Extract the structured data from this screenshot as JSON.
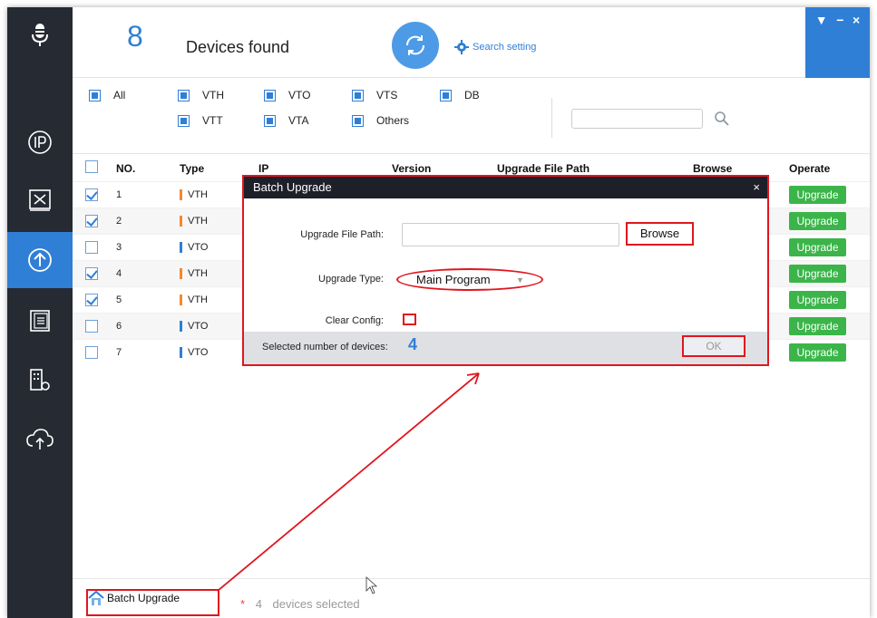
{
  "header": {
    "device_count": "8",
    "found_label": "Devices found",
    "search_setting_label": "Search setting",
    "window_controls": [
      "▼",
      "−",
      "×"
    ]
  },
  "filters": {
    "all_label": "All",
    "types": [
      {
        "label": "VTH"
      },
      {
        "label": "VTO"
      },
      {
        "label": "VTS"
      },
      {
        "label": "DB"
      },
      {
        "label": "VTT"
      },
      {
        "label": "VTA"
      },
      {
        "label": "Others"
      }
    ],
    "search_value": ""
  },
  "table": {
    "headers": {
      "no": "NO.",
      "type": "Type",
      "ip": "IP",
      "version": "Version",
      "upgrade_file_path": "Upgrade File Path",
      "browse": "Browse",
      "operate": "Operate"
    },
    "rows": [
      {
        "no": "1",
        "type": "VTH",
        "checked": true,
        "action": "Upgrade"
      },
      {
        "no": "2",
        "type": "VTH",
        "checked": true,
        "action": "Upgrade"
      },
      {
        "no": "3",
        "type": "VTO",
        "checked": false,
        "action": "Upgrade"
      },
      {
        "no": "4",
        "type": "VTH",
        "checked": true,
        "action": "Upgrade"
      },
      {
        "no": "5",
        "type": "VTH",
        "checked": true,
        "action": "Upgrade"
      },
      {
        "no": "6",
        "type": "VTO",
        "checked": false,
        "action": "Upgrade"
      },
      {
        "no": "7",
        "type": "VTO",
        "checked": false,
        "action": "Upgrade"
      }
    ]
  },
  "dialog": {
    "title": "Batch Upgrade",
    "close_label": "×",
    "file_path_label": "Upgrade File Path:",
    "file_path_value": "",
    "browse_label": "Browse",
    "upgrade_type_label": "Upgrade Type:",
    "upgrade_type_value": "Main Program",
    "clear_config_label": "Clear Config:",
    "clear_config_checked": false,
    "selected_label": "Selected number of devices:",
    "selected_count": "4",
    "ok_label": "OK"
  },
  "bottombar": {
    "batch_upgrade_label": "Batch Upgrade",
    "selected_count": "4",
    "selected_text": "devices selected"
  },
  "sidebar": {
    "items": [
      {
        "icon": "microphone-icon"
      },
      {
        "icon": "ip-icon"
      },
      {
        "icon": "tools-icon"
      },
      {
        "icon": "upgrade-icon",
        "active": true
      },
      {
        "icon": "document-icon"
      },
      {
        "icon": "building-settings-icon"
      },
      {
        "icon": "cloud-upload-icon"
      }
    ]
  },
  "colors": {
    "accent": "#2f7fd6",
    "sidebar_bg": "#252a33",
    "upgrade_green": "#3bb54a",
    "highlight_red": "#e0161f"
  }
}
